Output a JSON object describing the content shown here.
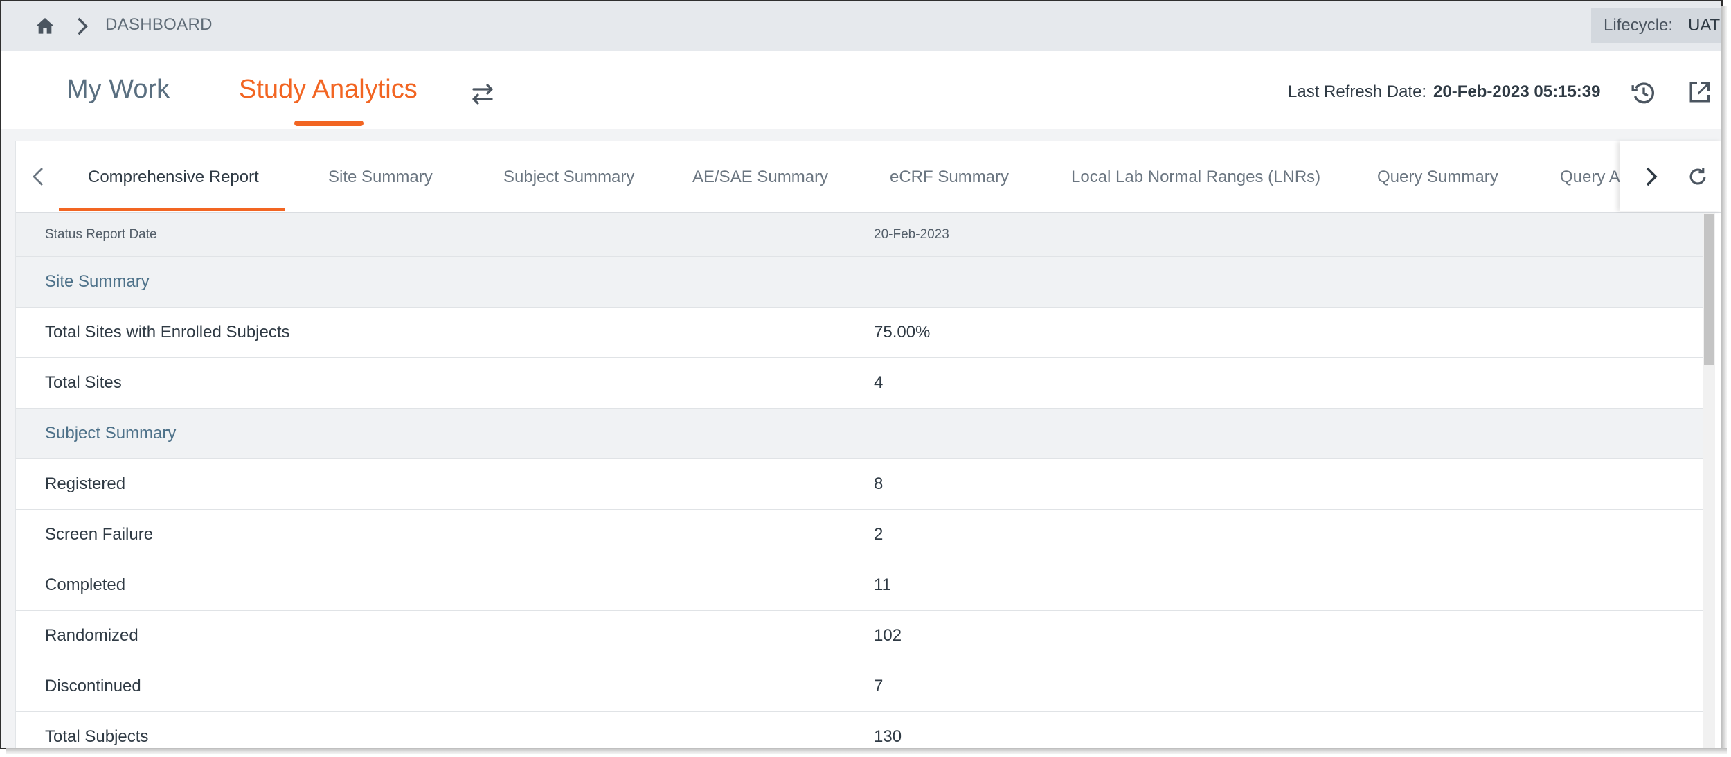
{
  "breadcrumb": {
    "home_icon": "home-icon",
    "separator_icon": "chevron-right-icon",
    "current": "DASHBOARD"
  },
  "lifecycle": {
    "label": "Lifecycle:",
    "value": "UAT"
  },
  "header": {
    "tabs": [
      {
        "label": "My Work",
        "active": false
      },
      {
        "label": "Study Analytics",
        "active": true
      }
    ],
    "swap_icon": "swap-arrows-icon",
    "last_refresh_label": "Last Refresh Date:",
    "last_refresh_value": "20-Feb-2023 05:15:39",
    "history_icon": "history-icon",
    "open_icon": "open-external-icon"
  },
  "report_tabs": {
    "items": [
      {
        "label": "Comprehensive Report",
        "active": true
      },
      {
        "label": "Site Summary",
        "active": false
      },
      {
        "label": "Subject Summary",
        "active": false
      },
      {
        "label": "AE/SAE Summary",
        "active": false
      },
      {
        "label": "eCRF Summary",
        "active": false
      },
      {
        "label": "Local Lab Normal Ranges (LNRs)",
        "active": false
      },
      {
        "label": "Query Summary",
        "active": false
      },
      {
        "label": "Query A",
        "active": false
      }
    ]
  },
  "table": {
    "header": {
      "label": "Status Report Date",
      "value": "20-Feb-2023"
    },
    "rows": [
      {
        "type": "section",
        "label": "Site Summary",
        "value": ""
      },
      {
        "type": "data",
        "label": "Total Sites with Enrolled Subjects",
        "value": "75.00%"
      },
      {
        "type": "data",
        "label": "Total Sites",
        "value": "4"
      },
      {
        "type": "section",
        "label": "Subject Summary",
        "value": ""
      },
      {
        "type": "data",
        "label": "Registered",
        "value": "8"
      },
      {
        "type": "data",
        "label": "Screen Failure",
        "value": "2"
      },
      {
        "type": "data",
        "label": "Completed",
        "value": "11"
      },
      {
        "type": "data",
        "label": "Randomized",
        "value": "102"
      },
      {
        "type": "data",
        "label": "Discontinued",
        "value": "7"
      },
      {
        "type": "data",
        "label": "Total Subjects",
        "value": "130"
      }
    ]
  },
  "colors": {
    "accent": "#f26522",
    "section_text": "#4d7189",
    "topbar_bg": "#e6e9ed"
  }
}
